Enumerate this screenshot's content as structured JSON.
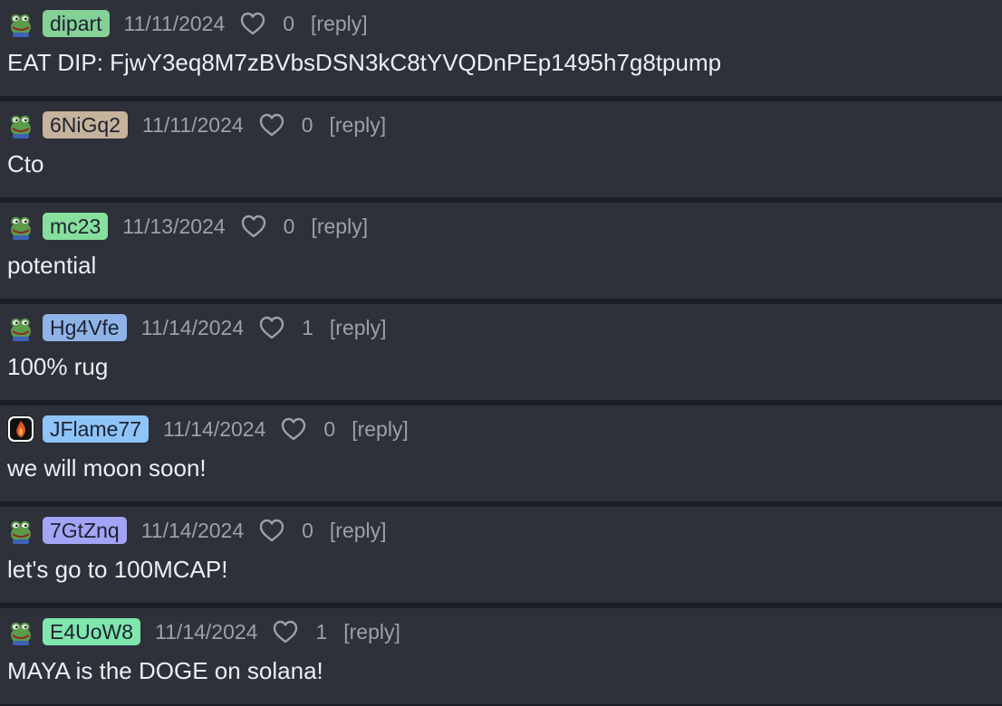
{
  "comments": [
    {
      "avatar": "pepe-avatar-icon",
      "username": "dipart",
      "user_color": "#84d095",
      "date": "11/11/2024",
      "likes": "0",
      "reply_label": "[reply]",
      "text": "EAT DIP: FjwY3eq8M7zBVbsDSN3kC8tYVQDnPEp1495h7g8tpump"
    },
    {
      "avatar": "pepe-avatar-icon",
      "username": "6NiGq2",
      "user_color": "#c6b39d",
      "date": "11/11/2024",
      "likes": "0",
      "reply_label": "[reply]",
      "text": "Cto"
    },
    {
      "avatar": "pepe-avatar-icon",
      "username": "mc23",
      "user_color": "#86df9c",
      "date": "11/13/2024",
      "likes": "0",
      "reply_label": "[reply]",
      "text": "potential"
    },
    {
      "avatar": "pepe-avatar-icon",
      "username": "Hg4Vfe",
      "user_color": "#8fb3e8",
      "date": "11/14/2024",
      "likes": "1",
      "reply_label": "[reply]",
      "text": "100% rug"
    },
    {
      "avatar": "flame-avatar-icon",
      "username": "JFlame77",
      "user_color": "#8ec4f8",
      "date": "11/14/2024",
      "likes": "0",
      "reply_label": "[reply]",
      "text": "we will moon soon!"
    },
    {
      "avatar": "pepe-avatar-icon",
      "username": "7GtZnq",
      "user_color": "#a4a4f6",
      "date": "11/14/2024",
      "likes": "0",
      "reply_label": "[reply]",
      "text": "let's go to 100MCAP!"
    },
    {
      "avatar": "pepe-avatar-icon",
      "username": "E4UoW8",
      "user_color": "#7fe6ac",
      "date": "11/14/2024",
      "likes": "1",
      "reply_label": "[reply]",
      "text": "MAYA is the DOGE on solana!"
    }
  ]
}
